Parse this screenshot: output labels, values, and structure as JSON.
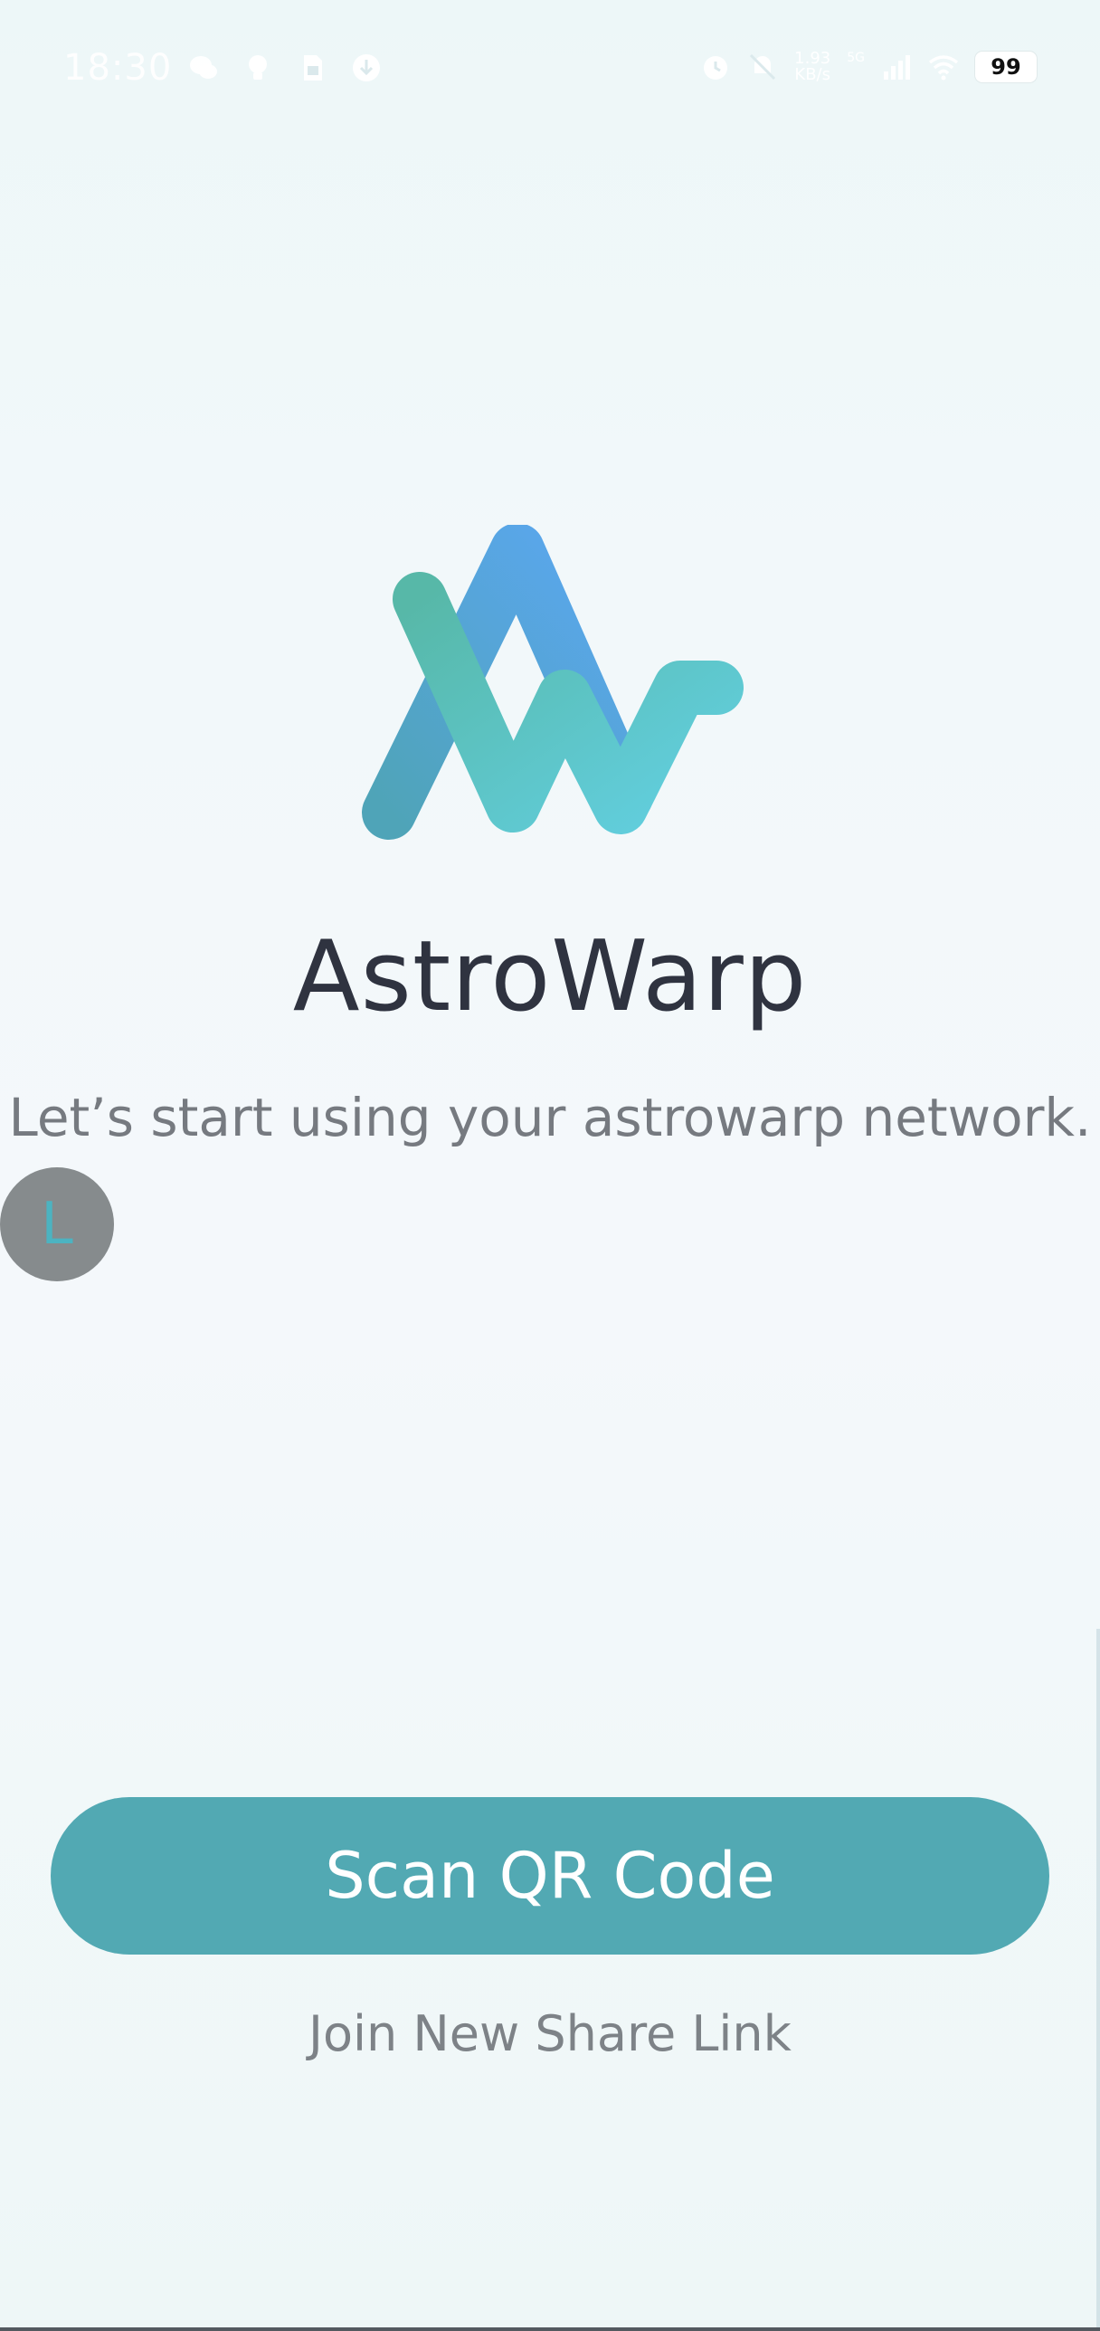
{
  "status_bar": {
    "time": "18:30",
    "speed_value": "1.93",
    "speed_unit": "KB/s",
    "network_type": "5G",
    "battery_level": "99",
    "left_icons": [
      "wechat-icon",
      "lightbulb-icon",
      "sim-card-icon",
      "download-icon"
    ],
    "right_icons": [
      "alarm-icon",
      "mute-icon",
      "signal-icon",
      "wifi-icon"
    ]
  },
  "app": {
    "title": "AstroWarp",
    "subtitle": "Let’s start using your astrowarp network.",
    "logo_icon": "astrowarp-logo-icon"
  },
  "floating_bubble": {
    "letter": "L"
  },
  "actions": {
    "scan_label": "Scan QR Code",
    "join_label": "Join New Share Link"
  },
  "colors": {
    "accent": "#52a9b3",
    "title": "#2f3340",
    "subtitle": "#767a80",
    "logo_blue": "#5aa2f0",
    "logo_teal": "#5ec7d4",
    "logo_green": "#5bb8a6"
  }
}
